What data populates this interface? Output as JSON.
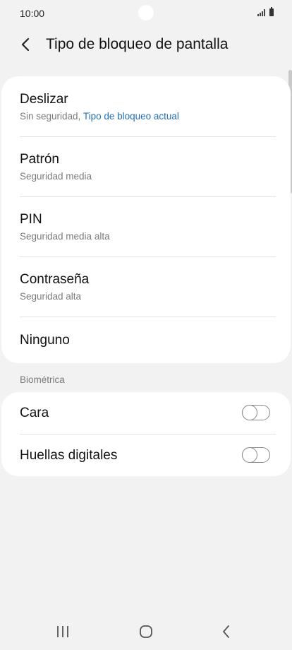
{
  "status_bar": {
    "time": "10:00"
  },
  "header": {
    "title": "Tipo de bloqueo de pantalla",
    "back_icon": "chevron-left-icon"
  },
  "lock_options": [
    {
      "title": "Deslizar",
      "subtitle": "Sin seguridad, ",
      "current_label": "Tipo de bloqueo actual"
    },
    {
      "title": "Patrón",
      "subtitle": "Seguridad media"
    },
    {
      "title": "PIN",
      "subtitle": "Seguridad media alta"
    },
    {
      "title": "Contraseña",
      "subtitle": "Seguridad alta"
    },
    {
      "title": "Ninguno"
    }
  ],
  "biometrics": {
    "section_label": "Biométrica",
    "items": [
      {
        "label": "Cara",
        "enabled": false
      },
      {
        "label": "Huellas digitales",
        "enabled": false
      }
    ]
  },
  "nav_bar": {
    "recents_icon": "recents-icon",
    "home_icon": "home-icon",
    "back_icon": "back-icon"
  },
  "colors": {
    "background": "#f2f2f2",
    "card": "#ffffff",
    "accent_link": "#1d6fc2",
    "secondary_text": "#7a7a7a"
  }
}
